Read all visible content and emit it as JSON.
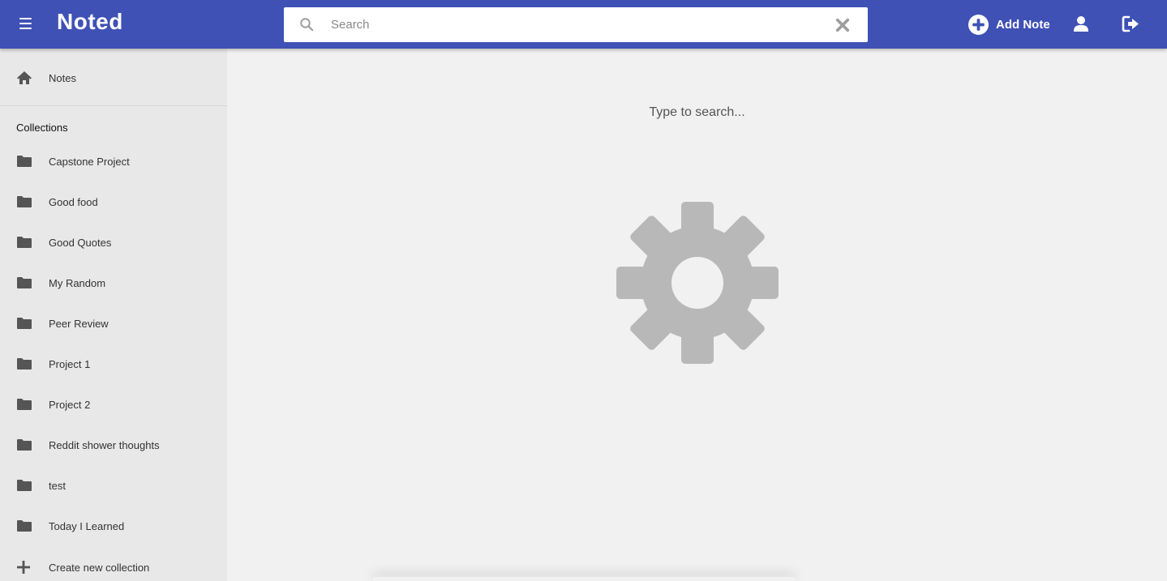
{
  "app": {
    "title": "Noted"
  },
  "header": {
    "menu_icon": "hamburger-icon",
    "search": {
      "placeholder": "Search",
      "value": ""
    },
    "add_note_label": "Add Note",
    "user_icon": "user-icon",
    "logout_icon": "sign-out-icon"
  },
  "sidebar": {
    "notes_label": "Notes",
    "collections_header": "Collections",
    "collections": [
      {
        "label": "Capstone Project",
        "icon": "folder-icon"
      },
      {
        "label": "Good food",
        "icon": "folder-icon"
      },
      {
        "label": "Good Quotes",
        "icon": "folder-icon"
      },
      {
        "label": "My Random",
        "icon": "folder-icon"
      },
      {
        "label": "Peer Review",
        "icon": "folder-icon"
      },
      {
        "label": "Project 1",
        "icon": "folder-icon"
      },
      {
        "label": "Project 2",
        "icon": "folder-icon"
      },
      {
        "label": "Reddit shower thoughts",
        "icon": "folder-icon"
      },
      {
        "label": "test",
        "icon": "folder-icon"
      },
      {
        "label": "Today I Learned",
        "icon": "folder-icon"
      }
    ],
    "create_label": "Create new collection"
  },
  "main": {
    "hint": "Type to search...",
    "loading_icon": "gear-icon"
  },
  "colors": {
    "primary": "#3f51b5",
    "sidebar_bg": "#e8e8e8",
    "main_bg": "#f1f1f1",
    "icon_gray": "#555555",
    "gear_gray": "#b8b8b8"
  }
}
